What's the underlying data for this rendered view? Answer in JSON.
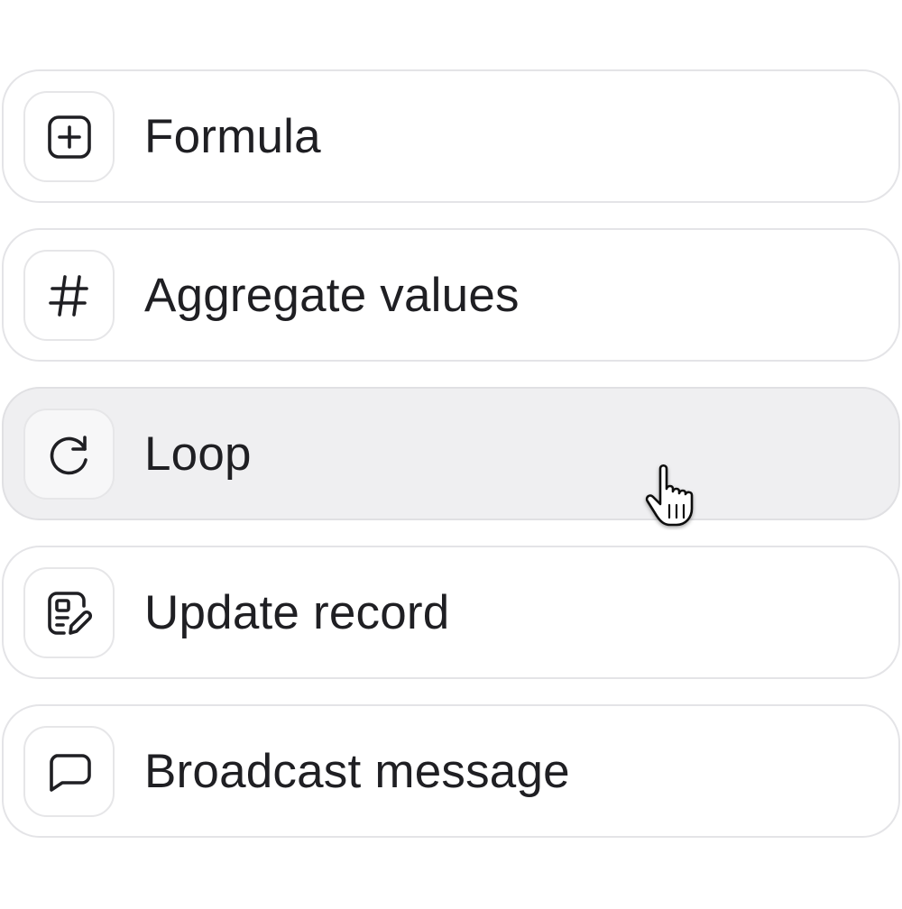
{
  "menu": {
    "items": [
      {
        "label": "Formula",
        "icon": "plus-square-icon",
        "state": "default"
      },
      {
        "label": "Aggregate values",
        "icon": "hash-icon",
        "state": "default"
      },
      {
        "label": "Loop",
        "icon": "refresh-icon",
        "state": "hovered"
      },
      {
        "label": "Update record",
        "icon": "edit-record-icon",
        "state": "default"
      },
      {
        "label": "Broadcast message",
        "icon": "message-square-icon",
        "state": "default"
      }
    ]
  },
  "colors": {
    "text": "#1f1f23",
    "border": "#e4e4e7",
    "hover_background": "#efeff1",
    "background": "#ffffff"
  },
  "cursor": {
    "icon": "hand-pointer-icon"
  }
}
